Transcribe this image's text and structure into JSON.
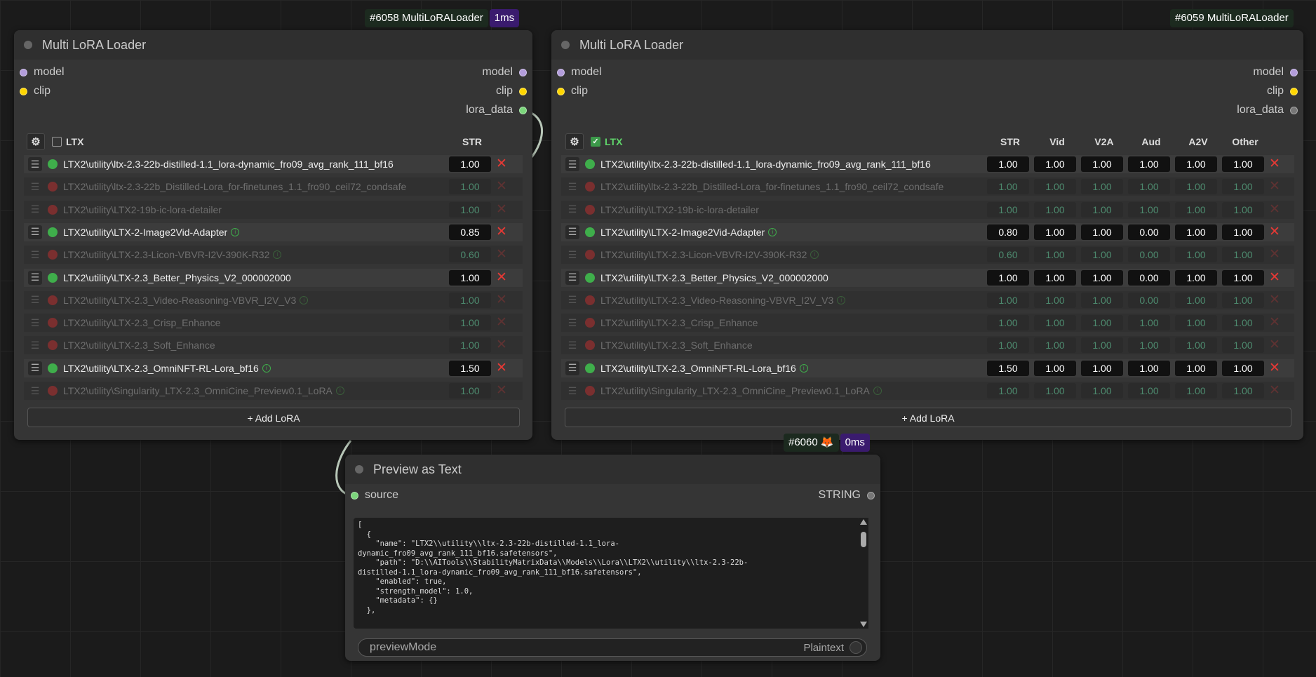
{
  "node1": {
    "badge_id": "#6058 MultiLoRALoader",
    "badge_time": "1ms",
    "title": "Multi LoRA Loader",
    "inputs": [
      {
        "label": "model",
        "color": "#b39ddb"
      },
      {
        "label": "clip",
        "color": "#ffd600"
      }
    ],
    "outputs": [
      {
        "label": "model",
        "color": "#b39ddb"
      },
      {
        "label": "clip",
        "color": "#ffd600"
      },
      {
        "label": "lora_data",
        "color": "#7cd67c"
      }
    ],
    "header_label": "LTX",
    "header_checked": false,
    "columns": [
      "STR"
    ],
    "loras": [
      {
        "name": "LTX2\\utility\\ltx-2.3-22b-distilled-1.1_lora-dynamic_fro09_avg_rank_111_bf16",
        "enabled": true,
        "info": false,
        "values": [
          "1.00"
        ]
      },
      {
        "name": "LTX2\\utility\\ltx-2.3-22b_Distilled-Lora_for-finetunes_1.1_fro90_ceil72_condsafe",
        "enabled": false,
        "info": false,
        "values": [
          "1.00"
        ]
      },
      {
        "name": "LTX2\\utility\\LTX2-19b-ic-lora-detailer",
        "enabled": false,
        "info": false,
        "values": [
          "1.00"
        ]
      },
      {
        "name": "LTX2\\utility\\LTX-2-Image2Vid-Adapter",
        "enabled": true,
        "info": true,
        "values": [
          "0.85"
        ]
      },
      {
        "name": "LTX2\\utility\\LTX-2.3-Licon-VBVR-I2V-390K-R32",
        "enabled": false,
        "info": true,
        "values": [
          "0.60"
        ]
      },
      {
        "name": "LTX2\\utility\\LTX-2.3_Better_Physics_V2_000002000",
        "enabled": true,
        "info": false,
        "values": [
          "1.00"
        ]
      },
      {
        "name": "LTX2\\utility\\LTX-2.3_Video-Reasoning-VBVR_I2V_V3",
        "enabled": false,
        "info": true,
        "values": [
          "1.00"
        ]
      },
      {
        "name": "LTX2\\utility\\LTX-2.3_Crisp_Enhance",
        "enabled": false,
        "info": false,
        "values": [
          "1.00"
        ]
      },
      {
        "name": "LTX2\\utility\\LTX-2.3_Soft_Enhance",
        "enabled": false,
        "info": false,
        "values": [
          "1.00"
        ]
      },
      {
        "name": "LTX2\\utility\\LTX-2.3_OmniNFT-RL-Lora_bf16",
        "enabled": true,
        "info": true,
        "values": [
          "1.50"
        ]
      },
      {
        "name": "LTX2\\utility\\Singularity_LTX-2.3_OmniCine_Preview0.1_LoRA",
        "enabled": false,
        "info": true,
        "values": [
          "1.00"
        ]
      }
    ],
    "add_label": "+ Add LoRA"
  },
  "node2": {
    "badge_id": "#6059 MultiLoRALoader",
    "title": "Multi LoRA Loader",
    "inputs": [
      {
        "label": "model",
        "color": "#b39ddb"
      },
      {
        "label": "clip",
        "color": "#ffd600"
      }
    ],
    "outputs": [
      {
        "label": "model",
        "color": "#b39ddb"
      },
      {
        "label": "clip",
        "color": "#ffd600"
      },
      {
        "label": "lora_data",
        "color": "#777777"
      }
    ],
    "header_label": "LTX",
    "header_checked": true,
    "columns": [
      "STR",
      "Vid",
      "V2A",
      "Aud",
      "A2V",
      "Other"
    ],
    "loras": [
      {
        "name": "LTX2\\utility\\ltx-2.3-22b-distilled-1.1_lora-dynamic_fro09_avg_rank_111_bf16",
        "enabled": true,
        "info": false,
        "values": [
          "1.00",
          "1.00",
          "1.00",
          "1.00",
          "1.00",
          "1.00"
        ]
      },
      {
        "name": "LTX2\\utility\\ltx-2.3-22b_Distilled-Lora_for-finetunes_1.1_fro90_ceil72_condsafe",
        "enabled": false,
        "info": false,
        "values": [
          "1.00",
          "1.00",
          "1.00",
          "1.00",
          "1.00",
          "1.00"
        ]
      },
      {
        "name": "LTX2\\utility\\LTX2-19b-ic-lora-detailer",
        "enabled": false,
        "info": false,
        "values": [
          "1.00",
          "1.00",
          "1.00",
          "1.00",
          "1.00",
          "1.00"
        ]
      },
      {
        "name": "LTX2\\utility\\LTX-2-Image2Vid-Adapter",
        "enabled": true,
        "info": true,
        "values": [
          "0.80",
          "1.00",
          "1.00",
          "0.00",
          "1.00",
          "1.00"
        ]
      },
      {
        "name": "LTX2\\utility\\LTX-2.3-Licon-VBVR-I2V-390K-R32",
        "enabled": false,
        "info": true,
        "values": [
          "0.60",
          "1.00",
          "1.00",
          "0.00",
          "1.00",
          "1.00"
        ]
      },
      {
        "name": "LTX2\\utility\\LTX-2.3_Better_Physics_V2_000002000",
        "enabled": true,
        "info": false,
        "values": [
          "1.00",
          "1.00",
          "1.00",
          "0.00",
          "1.00",
          "1.00"
        ]
      },
      {
        "name": "LTX2\\utility\\LTX-2.3_Video-Reasoning-VBVR_I2V_V3",
        "enabled": false,
        "info": true,
        "values": [
          "1.00",
          "1.00",
          "1.00",
          "0.00",
          "1.00",
          "1.00"
        ]
      },
      {
        "name": "LTX2\\utility\\LTX-2.3_Crisp_Enhance",
        "enabled": false,
        "info": false,
        "values": [
          "1.00",
          "1.00",
          "1.00",
          "1.00",
          "1.00",
          "1.00"
        ]
      },
      {
        "name": "LTX2\\utility\\LTX-2.3_Soft_Enhance",
        "enabled": false,
        "info": false,
        "values": [
          "1.00",
          "1.00",
          "1.00",
          "1.00",
          "1.00",
          "1.00"
        ]
      },
      {
        "name": "LTX2\\utility\\LTX-2.3_OmniNFT-RL-Lora_bf16",
        "enabled": true,
        "info": true,
        "values": [
          "1.50",
          "1.00",
          "1.00",
          "1.00",
          "1.00",
          "1.00"
        ]
      },
      {
        "name": "LTX2\\utility\\Singularity_LTX-2.3_OmniCine_Preview0.1_LoRA",
        "enabled": false,
        "info": true,
        "values": [
          "1.00",
          "1.00",
          "1.00",
          "1.00",
          "1.00",
          "1.00"
        ]
      }
    ],
    "add_label": "+ Add LoRA"
  },
  "node3": {
    "badge_id": "#6060 🦊",
    "badge_time": "0ms",
    "title": "Preview as Text",
    "input": {
      "label": "source",
      "color": "#7cd67c"
    },
    "output": {
      "label": "STRING",
      "color": "#777777"
    },
    "text": "[\n  {\n    \"name\": \"LTX2\\\\utility\\\\ltx-2.3-22b-distilled-1.1_lora-\ndynamic_fro09_avg_rank_111_bf16.safetensors\",\n    \"path\": \"D:\\\\AITools\\\\StabilityMatrixData\\\\Models\\\\Lora\\\\LTX2\\\\utility\\\\ltx-2.3-22b-\ndistilled-1.1_lora-dynamic_fro09_avg_rank_111_bf16.safetensors\",\n    \"enabled\": true,\n    \"strength_model\": 1.0,\n    \"metadata\": {}\n  },",
    "widget_label": "previewMode",
    "widget_value": "Plaintext"
  },
  "colors": {
    "enabled": "#3fae4b",
    "disabled": "#7a2f2f",
    "remove": "#e53935",
    "link": "#b8c7b8"
  }
}
